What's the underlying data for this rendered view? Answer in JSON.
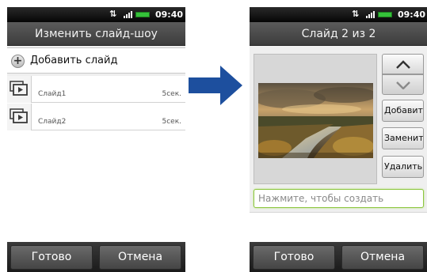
{
  "status_bar": {
    "usb_symbol": "⌗",
    "time": "09:40"
  },
  "left_screen": {
    "title": "Изменить слайд-шоу",
    "add_slide_label": "Добавить слайд",
    "slides": [
      {
        "name": "Слайд1",
        "duration": "5сек."
      },
      {
        "name": "Слайд2",
        "duration": "5сек."
      }
    ],
    "done_label": "Готово",
    "cancel_label": "Отмена"
  },
  "right_screen": {
    "title": "Слайд 2 из 2",
    "add_label": "Добавить",
    "replace_label": "Заменить",
    "delete_label": "Удалить",
    "caption_placeholder": "Нажмите, чтобы создать",
    "done_label": "Готово",
    "cancel_label": "Отмена"
  },
  "colors": {
    "arrow": "#1d4f9e",
    "input_border": "#8cc63f",
    "battery": "#35c13a"
  }
}
